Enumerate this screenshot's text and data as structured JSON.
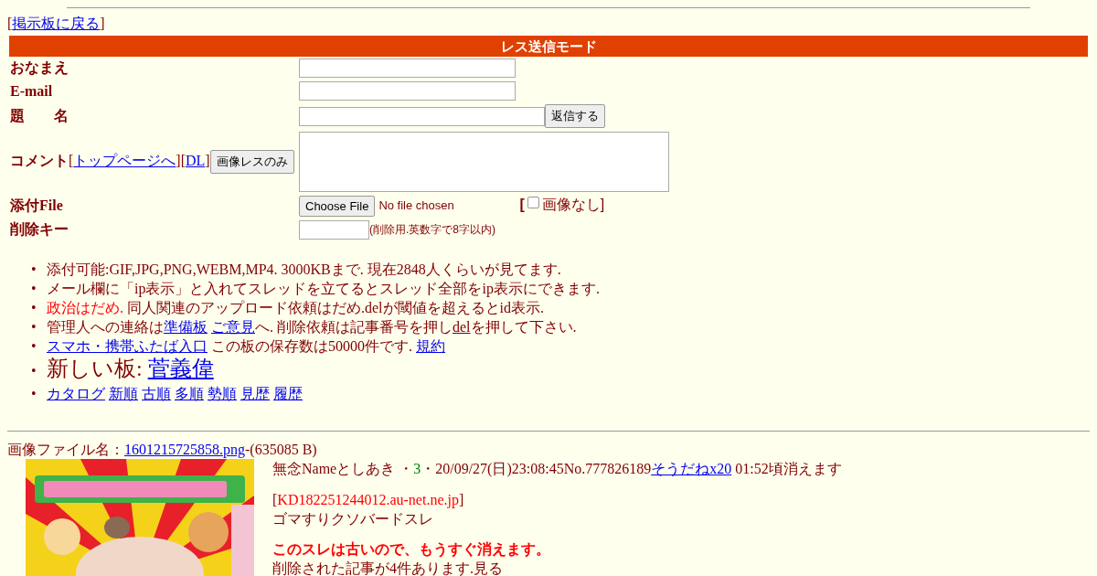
{
  "back_link": {
    "open": "[",
    "label": "掲示板に戻る",
    "close": "]"
  },
  "form": {
    "title": "レス送信モード",
    "name_label": "おなまえ",
    "email_label": "E-mail",
    "subject_label": "題　　名",
    "submit_button": "返信する",
    "comment_label": "コメント",
    "top_link_open": "[",
    "top_link": "トップページへ",
    "dl_link_open": "][",
    "dl_link": "DL",
    "dl_link_close": "]",
    "image_only_button": "画像レスのみ",
    "file_label": "添付File",
    "file_button": "Choose File",
    "file_status": "No file chosen",
    "no_image_open": "[",
    "no_image_label": "画像なし",
    "no_image_close": "]",
    "no_image_checked": false,
    "delete_key_label": "削除キー",
    "delete_key_note": "(削除用.英数字で8字以内)"
  },
  "notes": [
    {
      "bullet": "•",
      "large": false,
      "segments": [
        {
          "kind": "text",
          "text": "添付可能:GIF,JPG,PNG,WEBM,MP4. 3000KBまで. 現在2848人くらいが見てます."
        }
      ]
    },
    {
      "bullet": "•",
      "large": false,
      "segments": [
        {
          "kind": "text",
          "text": "メール欄に「ip表示」と入れてスレッドを立てるとスレッド全部をip表示にできます."
        }
      ]
    },
    {
      "bullet": "•",
      "large": false,
      "segments": [
        {
          "kind": "alert",
          "text": "政治はだめ."
        },
        {
          "kind": "text",
          "text": " 同人関連のアップロード依頼はだめ.delが閾値を超えるとid表示."
        }
      ]
    },
    {
      "bullet": "•",
      "large": false,
      "segments": [
        {
          "kind": "text",
          "text": "管理人への連絡は"
        },
        {
          "kind": "link",
          "text": "準備板"
        },
        {
          "kind": "link",
          "text": "ご意見"
        },
        {
          "kind": "text",
          "text": "へ. 削除依頼は記事番号を押し"
        },
        {
          "kind": "plain_link",
          "text": "del"
        },
        {
          "kind": "text",
          "text": "を押して下さい."
        }
      ]
    },
    {
      "bullet": "•",
      "large": false,
      "segments": [
        {
          "kind": "link",
          "text": "スマホ・携帯ふたば入口"
        },
        {
          "kind": "text",
          "text": " この板の保存数は50000件です. "
        },
        {
          "kind": "link",
          "text": "規約"
        }
      ]
    },
    {
      "bullet": "•",
      "large": true,
      "segments": [
        {
          "kind": "text",
          "text": "新しい板: "
        },
        {
          "kind": "link",
          "text": "菅義偉"
        }
      ]
    },
    {
      "bullet": "•",
      "large": false,
      "segments": [
        {
          "kind": "link",
          "text": "カタログ"
        },
        {
          "kind": "link",
          "text": "新順"
        },
        {
          "kind": "link",
          "text": "古順"
        },
        {
          "kind": "link",
          "text": "多順"
        },
        {
          "kind": "link",
          "text": "勢順"
        },
        {
          "kind": "link",
          "text": "見歴"
        },
        {
          "kind": "link",
          "text": "履歴"
        }
      ]
    }
  ],
  "thread": {
    "file_label": "画像ファイル名：",
    "file_link": "1601215725858.png",
    "file_size": "-(635085 B)",
    "subject": "無念",
    "name_label": "Name",
    "name": "としあき",
    "id_mark": "・",
    "count": "3",
    "id_mark_after": "・",
    "datetime": "20/09/27(日)23:08:45",
    "number": "No.777826189",
    "sodane_link": "そうだねx20",
    "expire": "01:52頃消えます",
    "ip_open": "[",
    "ip": "KD182251244012.au-net.ne.jp",
    "ip_close": "]",
    "body": "ゴマすりクソバードスレ",
    "warning": "このスレは古いので、もうすぐ消えます。",
    "deleted_note": "削除された記事が4件あります.見る"
  }
}
